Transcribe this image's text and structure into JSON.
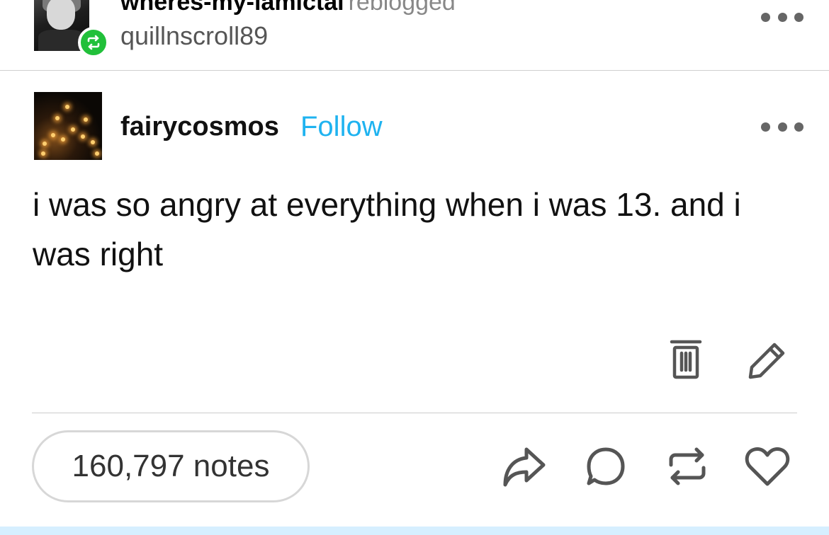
{
  "reblog_header": {
    "rebloggers_name": "wheres-my-lamictal",
    "verb": "reblogged",
    "source_name": "quillnscroll89"
  },
  "post": {
    "author": "fairycosmos",
    "follow_label": "Follow",
    "body": "i was so angry at everything when i was 13. and i was right"
  },
  "footer": {
    "notes_label": "160,797 notes"
  },
  "icons": {
    "reblog_badge": "reblog-icon",
    "more": "more-options-icon",
    "delete": "trash-icon",
    "edit": "pencil-icon",
    "share": "share-icon",
    "reply": "comment-icon",
    "reblog": "reblog-icon",
    "like": "heart-icon"
  },
  "colors": {
    "follow_link": "#1fb3f0",
    "reblog_badge": "#21c03a",
    "icon": "#555555"
  }
}
